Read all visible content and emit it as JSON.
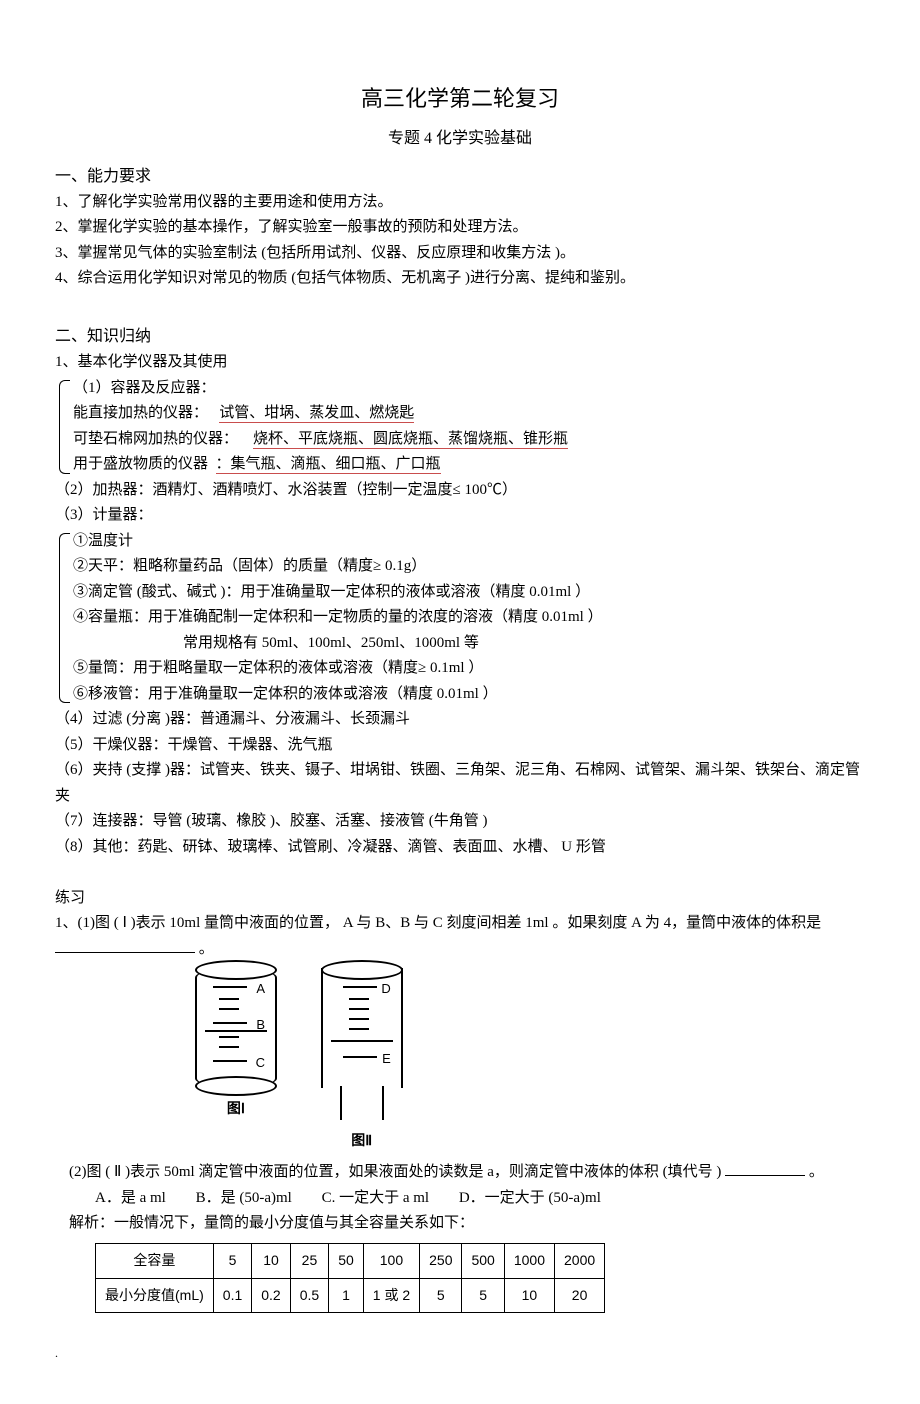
{
  "title": "高三化学第二轮复习",
  "subtitle": "专题 4  化学实验基础",
  "section1": {
    "heading": "一、能力要求",
    "p1": "1、了解化学实验常用仪器的主要用途和使用方法。",
    "p2": "2、掌握化学实验的基本操作，了解实验室一般事故的预防和处理方法。",
    "p3": "3、掌握常见气体的实验室制法     (包括所用试剂、仪器、反应原理和收集方法       )。",
    "p4": "4、综合运用化学知识对常见的物质      (包括气体物质、无机离子     )进行分离、提纯和鉴别。"
  },
  "section2": {
    "heading": "二、知识归纳",
    "item1_title": "1、基本化学仪器及其使用",
    "g1": {
      "l1a": "（1）容器及反应器：",
      "l2a": "能直接加热的仪器：",
      "l2b": "试管、坩埚、蒸发皿、燃烧匙",
      "l3a": "可垫石棉网加热的仪器：",
      "l3b": "烧杯、平底烧瓶、圆底烧瓶、蒸馏烧瓶、锥形瓶",
      "l4a": "用于盛放物质的仪器",
      "l4b": "：集气瓶、滴瓶、细口瓶、广口瓶"
    },
    "p2": "（2）加热器：酒精灯、酒精喷灯、水浴装置（控制一定温度≤         100℃）",
    "p3": "（3）计量器：",
    "g2": {
      "l1": "①温度计",
      "l2": "②天平：粗略称量药品（固体）的质量（精度≥         0.1g）",
      "l3": "③滴定管 (酸式、碱式  )：用于准确量取一定体积的液体或溶液（精度           0.01ml ）",
      "l4": "④容量瓶：用于准确配制一定体积和一定物质的量的浓度的溶液（精度              0.01ml ）",
      "l4b": "常用规格有   50ml、100ml、250ml、1000ml  等",
      "l5": "⑤量筒：用于粗略量取一定体积的液体或溶液（精度≥           0.1ml ）",
      "l6": "⑥移液管：用于准确量取一定体积的液体或溶液（精度           0.01ml ）"
    },
    "p4": "（4）过滤 (分离 )器：普通漏斗、分液漏斗、长颈漏斗",
    "p5": "（5）干燥仪器：干燥管、干燥器、洗气瓶",
    "p6": "（6）夹持 (支撑 )器：试管夹、铁夹、镊子、坩埚钳、铁圈、三角架、泥三角、石棉网、试管架、漏斗架、铁架台、滴定管夹",
    "p7": "（7）连接器：导管   (玻璃、橡胶  )、胶塞、活塞、接液管     (牛角管 )",
    "p8": "（8）其他：药匙、研钵、玻璃棒、试管刷、冷凝器、滴管、表面皿、水槽、           U 形管"
  },
  "practice": {
    "heading": "练习",
    "q1a": "1、(1)图 ( Ⅰ )表示  10ml  量筒中液面的位置，     A 与 B、B 与 C 刻度间相差   1ml 。如果刻度   A 为 4，量筒中液体的体积是 ",
    "q1b": "。",
    "fig1_labels": {
      "A": "A",
      "B": "B",
      "C": "C"
    },
    "fig2_labels": {
      "D": "D",
      "E": "E"
    },
    "fig1_caption": "图Ⅰ",
    "fig2_caption": "图Ⅱ",
    "q2a": "(2)图 ( Ⅱ )表示  50ml 滴定管中液面的位置，如果液面处的读数是         a，则滴定管中液体的体积   (填代号 )",
    "q2b": "。",
    "opts": {
      "A": "A．是 a ml",
      "B": "B．是 (50-a)ml",
      "C": "C. 一定大于  a ml",
      "D": "D．一定大于  (50-a)ml"
    },
    "analysis": "解析：一般情况下，量筒的最小分度值与其全容量关系如下：",
    "table": {
      "header": "全容量",
      "cols": [
        "5",
        "10",
        "25",
        "50",
        "100",
        "250",
        "500",
        "1000",
        "2000"
      ],
      "row_label": "最小分度值(mL)",
      "vals": [
        "0.1",
        "0.2",
        "0.5",
        "1",
        "1 或 2",
        "5",
        "5",
        "10",
        "20"
      ]
    }
  },
  "footer_dot": "."
}
